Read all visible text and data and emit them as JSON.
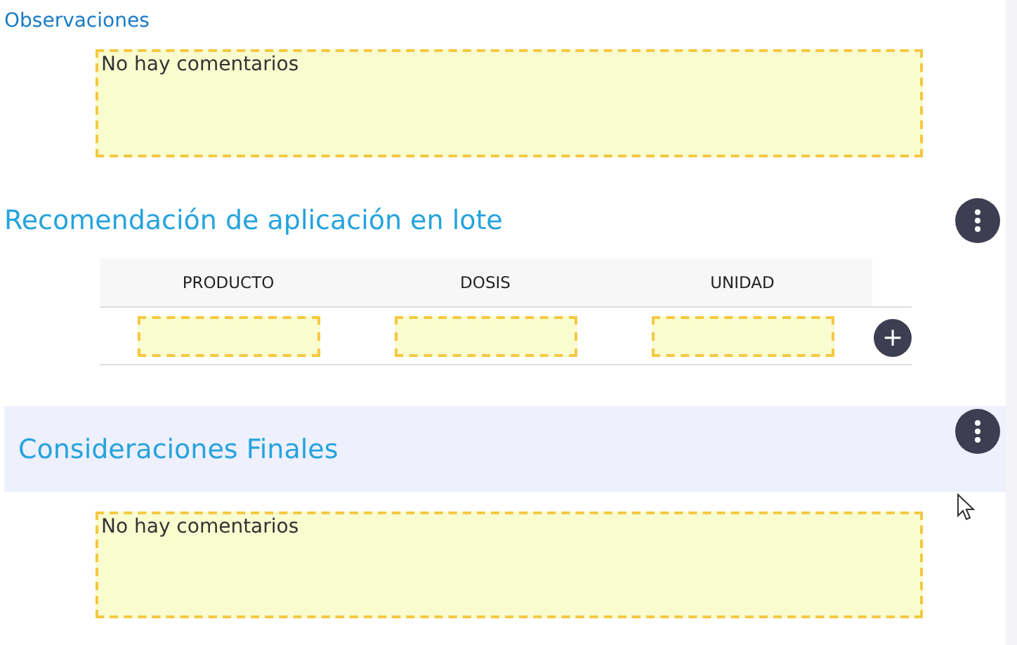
{
  "sections": [
    {
      "kind": "comments",
      "title": "Observaciones",
      "text": "No hay comentarios"
    },
    {
      "kind": "table",
      "title": "Recomendación de aplicación en lote",
      "highlighted": false,
      "menu": true,
      "columns": [
        "PRODUCTO",
        "DOSIS",
        "UNIDAD"
      ],
      "add_button": "+"
    },
    {
      "kind": "notes",
      "title": "Consideraciones Finales",
      "highlighted": true,
      "menu": true,
      "text": "No hay comentarios"
    }
  ]
}
